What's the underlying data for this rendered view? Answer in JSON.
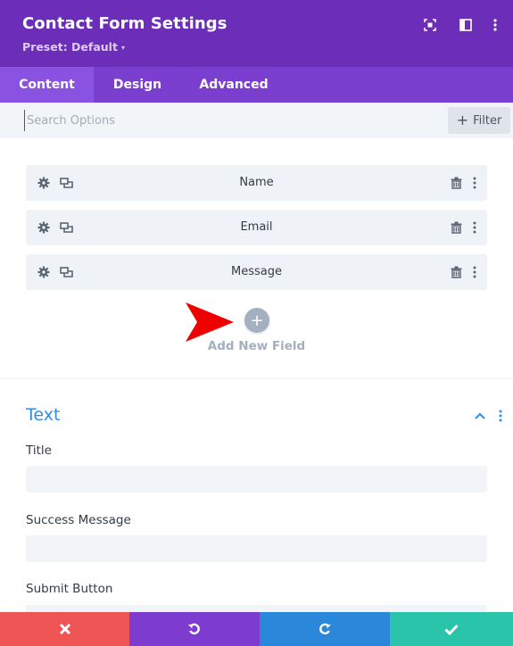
{
  "header": {
    "title": "Contact Form Settings",
    "preset": "Preset: Default",
    "preset_caret": "▾",
    "icons": [
      "focus-icon",
      "split-view-icon",
      "more-options-icon"
    ]
  },
  "tabs": [
    {
      "label": "Content",
      "active": true
    },
    {
      "label": "Design",
      "active": false
    },
    {
      "label": "Advanced",
      "active": false
    }
  ],
  "search": {
    "placeholder": "Search Options",
    "value": "",
    "filter_label": "Filter",
    "filter_plus": "+"
  },
  "fields": [
    {
      "label": "Name"
    },
    {
      "label": "Email"
    },
    {
      "label": "Message"
    }
  ],
  "add_field": {
    "label": "Add New Field",
    "plus": "+"
  },
  "text_section": {
    "title": "Text",
    "inputs": [
      {
        "label": "Title",
        "value": ""
      },
      {
        "label": "Success Message",
        "value": ""
      },
      {
        "label": "Submit Button",
        "value": ""
      }
    ]
  },
  "bottom_actions": [
    {
      "name": "discard-icon",
      "color": "#ef5555"
    },
    {
      "name": "undo-icon",
      "color": "#7e3bd0"
    },
    {
      "name": "redo-icon",
      "color": "#2b87da"
    },
    {
      "name": "save-check-icon",
      "color": "#29c4a9"
    }
  ],
  "colors": {
    "header": "#6c2eb9",
    "tabs": "#7b3fd0",
    "active_tab": "#8a52e0",
    "accent_blue": "#2e8ee8",
    "annotation_arrow": "#ee0000"
  }
}
